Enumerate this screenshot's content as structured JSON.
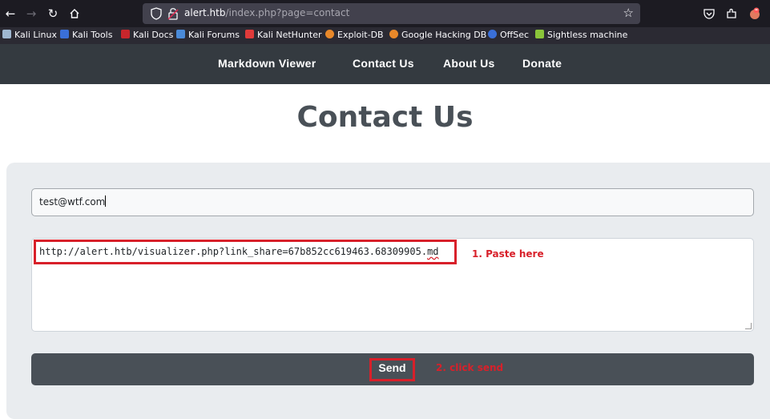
{
  "browser": {
    "url_host": "alert.htb",
    "url_path": "/index.php?page=contact",
    "bookmarks": [
      "Kali Linux",
      "Kali Tools",
      "Kali Docs",
      "Kali Forums",
      "Kali NetHunter",
      "Exploit-DB",
      "Google Hacking DB",
      "OffSec",
      "Sightless machine"
    ]
  },
  "nav": {
    "items": [
      "Markdown Viewer",
      "Contact Us",
      "About Us",
      "Donate"
    ]
  },
  "page": {
    "title": "Contact Us"
  },
  "form": {
    "email_value": "test@wtf.com",
    "message_value": "http://alert.htb/visualizer.php?link_share=67b852cc619463.68309905.",
    "message_tail": "md",
    "send_label": "Send"
  },
  "annotations": {
    "paste_here": "1. Paste here",
    "click_send": "2. click send"
  },
  "colors": {
    "annotation": "#d8202a",
    "nav_bg": "#343a40",
    "send_bg": "#495057"
  }
}
